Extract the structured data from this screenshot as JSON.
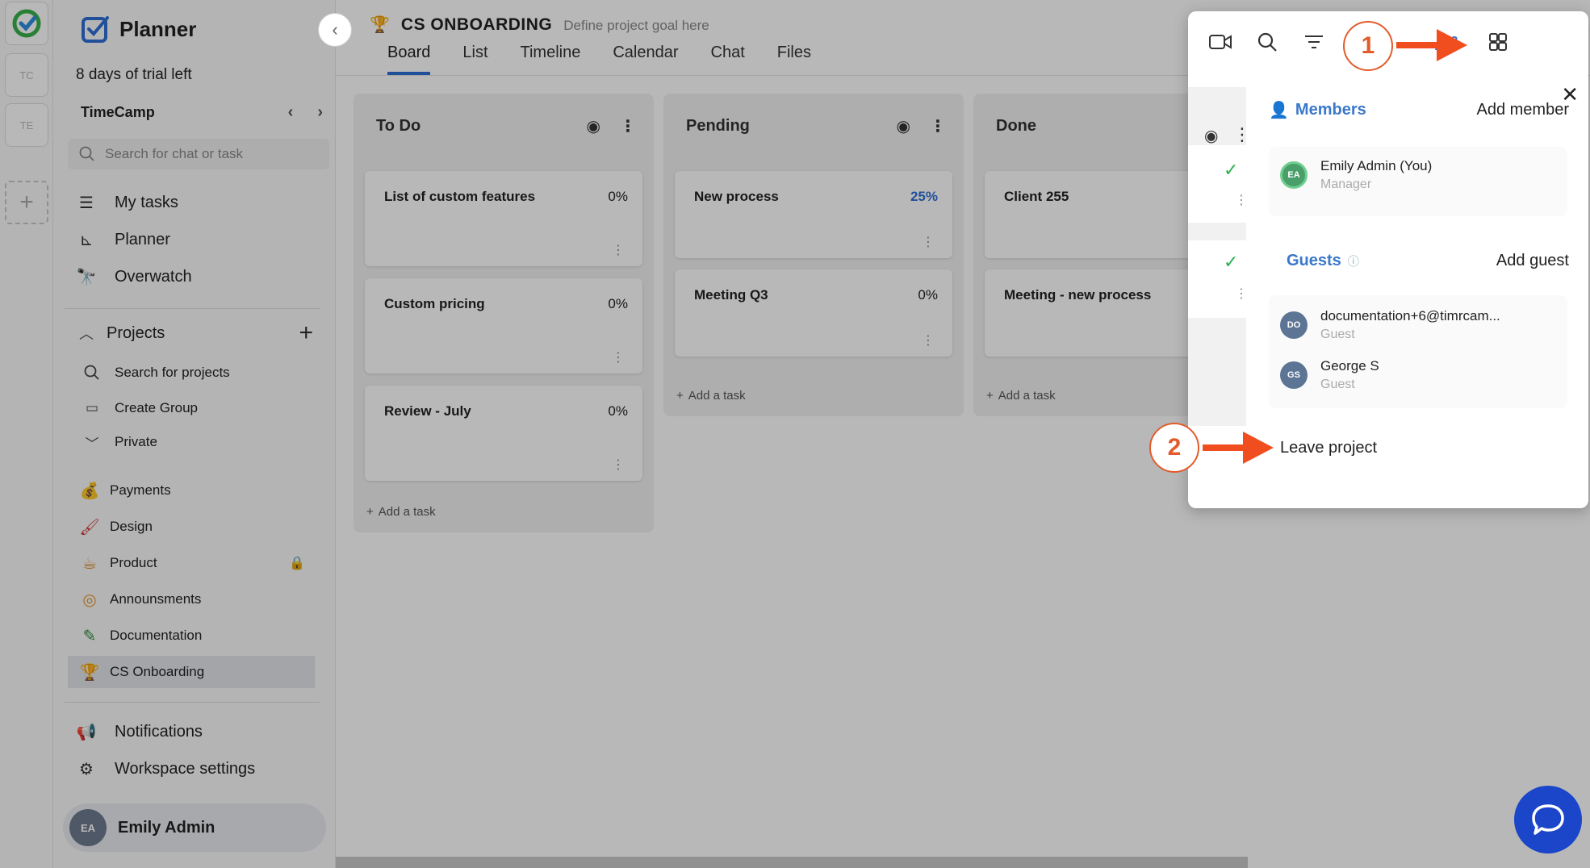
{
  "app": {
    "name": "Planner",
    "trial": "8 days of trial left"
  },
  "rail": {
    "workspaces": [
      "TC",
      "TE"
    ]
  },
  "sidebar": {
    "workspace": "TimeCamp",
    "search_placeholder": "Search for chat or task",
    "nav": [
      {
        "label": "My tasks",
        "icon": "task-list-icon"
      },
      {
        "label": "Planner",
        "icon": "chart-icon"
      },
      {
        "label": "Overwatch",
        "icon": "telescope-icon"
      }
    ],
    "projects_label": "Projects",
    "project_actions": [
      {
        "label": "Search for projects",
        "icon": "search-icon"
      },
      {
        "label": "Create Group",
        "icon": "folders-icon"
      },
      {
        "label": "Private",
        "icon": "chevron-down-icon"
      }
    ],
    "projects": [
      {
        "label": "Payments",
        "icon": "money-bag-icon",
        "color": "#8e4aa8"
      },
      {
        "label": "Design",
        "icon": "brush-icon",
        "color": "#d23a3a"
      },
      {
        "label": "Product",
        "icon": "coffee-icon",
        "color": "#d98b2b",
        "locked": true
      },
      {
        "label": "Announsments",
        "icon": "target-icon",
        "color": "#e8952b"
      },
      {
        "label": "Documentation",
        "icon": "pen-icon",
        "color": "#2e8b3e"
      },
      {
        "label": "CS Onboarding",
        "icon": "trophy-icon",
        "color": "#3a65b0",
        "active": true
      }
    ],
    "notifications": "Notifications",
    "settings": "Workspace settings",
    "user": {
      "name": "Emily Admin",
      "initials": "EA"
    }
  },
  "project": {
    "title": "CS ONBOARDING",
    "goal_placeholder": "Define project goal here",
    "tabs": [
      "Board",
      "List",
      "Timeline",
      "Calendar",
      "Chat",
      "Files"
    ],
    "active_tab": "Board"
  },
  "board": {
    "add_task": "Add a task",
    "columns": [
      {
        "name": "To Do",
        "cards": [
          {
            "name": "List of custom features",
            "pct": "0%"
          },
          {
            "name": "Custom pricing",
            "pct": "0%"
          },
          {
            "name": "Review - July",
            "pct": "0%"
          }
        ]
      },
      {
        "name": "Pending",
        "cards": [
          {
            "name": "New process",
            "pct": "25%"
          },
          {
            "name": "Meeting Q3",
            "pct": "0%"
          }
        ]
      },
      {
        "name": "Done",
        "cards": [
          {
            "name": "Client 255"
          },
          {
            "name": "Meeting - new process"
          }
        ]
      }
    ]
  },
  "popup": {
    "member_count": "3",
    "members_label": "Members",
    "add_member": "Add member",
    "members": [
      {
        "name": "Emily Admin (You)",
        "role": "Manager",
        "initials": "EA"
      }
    ],
    "guests_label": "Guests",
    "add_guest": "Add guest",
    "guests": [
      {
        "name": "documentation+6@timrcam...",
        "role": "Guest",
        "initials": "DO"
      },
      {
        "name": "George S",
        "role": "Guest",
        "initials": "GS"
      }
    ],
    "leave": "Leave project"
  },
  "annotations": {
    "step1": "1",
    "step2": "2"
  },
  "colors": {
    "accent": "#2f6fd6",
    "annotation": "#f04e1f",
    "chat": "#1b46c9"
  }
}
